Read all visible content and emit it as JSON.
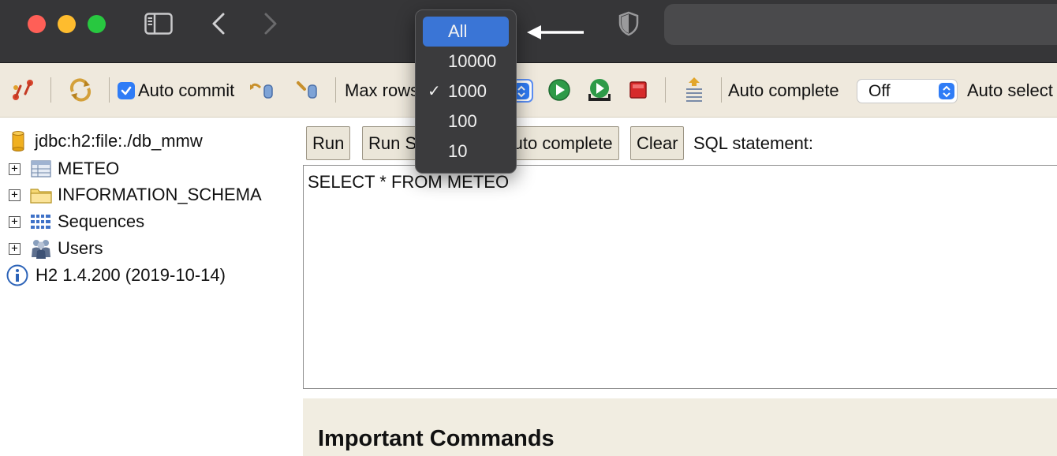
{
  "browser": {
    "traffic_lights": [
      "close",
      "minimize",
      "zoom"
    ],
    "icons": [
      "sidebar-toggle-icon",
      "chevron-left-icon",
      "chevron-right-icon",
      "shield-icon"
    ]
  },
  "toolbar": {
    "auto_commit_label": "Auto commit",
    "auto_commit_checked": true,
    "max_rows_label": "Max rows",
    "auto_complete_label": "Auto complete",
    "auto_complete_value": "Off",
    "auto_select_label": "Auto select"
  },
  "max_rows_menu": {
    "options": [
      "All",
      "10000",
      "1000",
      "100",
      "10"
    ],
    "highlighted": "All",
    "checked": "1000",
    "check_mark": "✓"
  },
  "tree": {
    "connection": "jdbc:h2:file:./db_mmw",
    "items": [
      {
        "label": "METEO",
        "expander": "+"
      },
      {
        "label": "INFORMATION_SCHEMA",
        "expander": "+"
      },
      {
        "label": "Sequences",
        "expander": "+"
      },
      {
        "label": "Users",
        "expander": "+"
      }
    ],
    "version": "H2 1.4.200 (2019-10-14)"
  },
  "query": {
    "run_label": "Run",
    "run_selected_label": "Run Selected",
    "auto_complete_label": "Auto complete",
    "clear_label": "Clear",
    "sql_label": "SQL statement:",
    "sql_text": "SELECT * FROM METEO"
  },
  "help": {
    "title": "Important Commands"
  },
  "colors": {
    "chrome": "#363638",
    "toolbar": "#efe9dd",
    "accent": "#3a75d6",
    "menu": "#3b3b3d"
  }
}
